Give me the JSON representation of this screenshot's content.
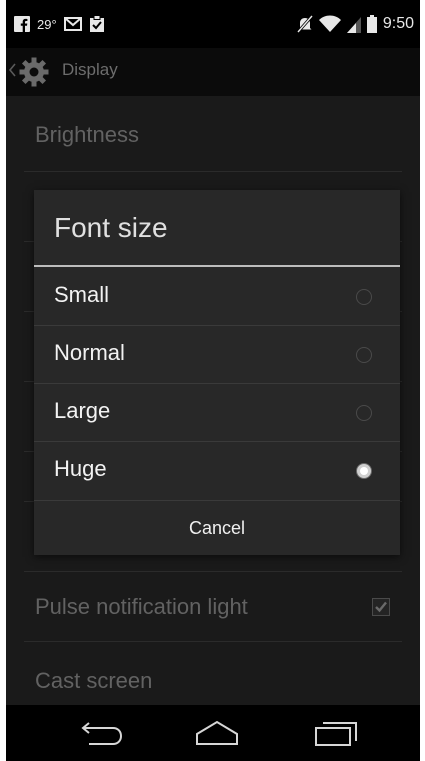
{
  "status_bar": {
    "temperature": "29°",
    "time": "9:50",
    "icons": [
      "facebook-icon",
      "gmail-icon",
      "clipboard-icon",
      "mute-icon",
      "wifi-icon",
      "signal-icon",
      "battery-icon"
    ]
  },
  "action_bar": {
    "title": "Display",
    "icons": [
      "up-caret-icon",
      "settings-gear-icon"
    ]
  },
  "settings": {
    "items": [
      {
        "label": "Brightness"
      },
      {
        "label": "Pulse notification light",
        "checked": true
      },
      {
        "label": "Cast screen"
      }
    ]
  },
  "dialog": {
    "title": "Font size",
    "options": [
      {
        "label": "Small",
        "selected": false
      },
      {
        "label": "Normal",
        "selected": false
      },
      {
        "label": "Large",
        "selected": false
      },
      {
        "label": "Huge",
        "selected": true
      }
    ],
    "cancel_label": "Cancel"
  },
  "nav_bar": {
    "icons": [
      "back-icon",
      "home-icon",
      "recent-apps-icon"
    ]
  },
  "colors": {
    "background": "#000000",
    "dialog_background": "#282828",
    "dim_text": "#626262",
    "bright_text": "#f2f2f2"
  }
}
